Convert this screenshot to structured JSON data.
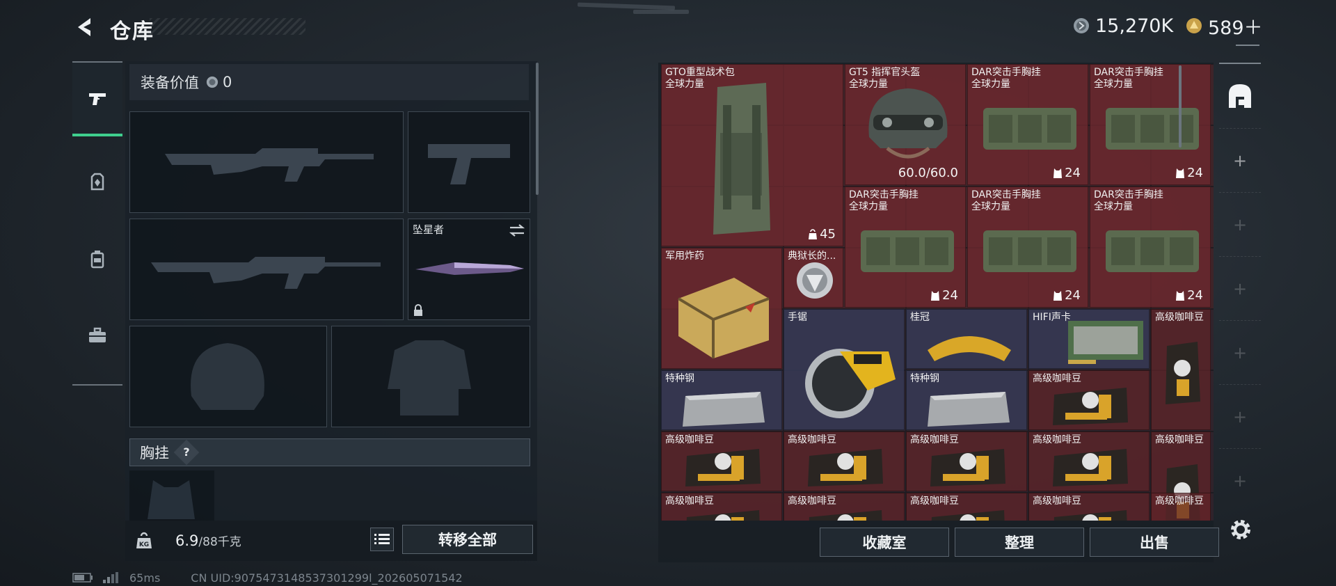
{
  "header": {
    "title": "仓库",
    "currency1": "15,270K",
    "currency2": "589＋"
  },
  "tabs_left": [
    {
      "name": "weapon"
    },
    {
      "name": "armor"
    },
    {
      "name": "backpack"
    },
    {
      "name": "toolbox"
    }
  ],
  "loadout": {
    "value_label": "装备价值",
    "value": "0",
    "melee_name": "坠星者",
    "section_chest": "胸挂",
    "section_help": "?",
    "weight": "6.9",
    "weight_max": "/88千克",
    "transfer_all": "转移全部"
  },
  "inventory": {
    "items": [
      {
        "name": "GTO重型战术包\n全球力量",
        "count": "45",
        "count_icon": "weight"
      },
      {
        "name": "GT5 指挥官头盔\n全球力量",
        "count": "60.0/60.0",
        "count_icon": ""
      },
      {
        "name": "DAR突击手胸挂\n全球力量",
        "count": "24",
        "count_icon": "vest"
      },
      {
        "name": "DAR突击手胸挂\n全球力量",
        "count": "24",
        "count_icon": "vest"
      },
      {
        "name": "DAR突击手胸挂\n全球力量",
        "count": "24",
        "count_icon": "vest"
      },
      {
        "name": "DAR突击手胸挂\n全球力量",
        "count": "24",
        "count_icon": "vest"
      },
      {
        "name": "DAR突击手胸挂\n全球力量",
        "count": "24",
        "count_icon": "vest"
      },
      {
        "name": "军用炸药",
        "count": "",
        "count_icon": ""
      },
      {
        "name": "典狱长的...",
        "count": "",
        "count_icon": ""
      },
      {
        "name": "手锯",
        "count": "",
        "count_icon": ""
      },
      {
        "name": "桂冠",
        "count": "",
        "count_icon": ""
      },
      {
        "name": "HIFI声卡",
        "count": "",
        "count_icon": ""
      },
      {
        "name": "高级咖啡豆",
        "count": "",
        "count_icon": ""
      },
      {
        "name": "特种钢",
        "count": "",
        "count_icon": ""
      },
      {
        "name": "特种钢",
        "count": "",
        "count_icon": ""
      },
      {
        "name": "高级咖啡豆",
        "count": "",
        "count_icon": ""
      },
      {
        "name": "高级咖啡豆",
        "count": "",
        "count_icon": ""
      },
      {
        "name": "高级咖啡豆",
        "count": "",
        "count_icon": ""
      },
      {
        "name": "高级咖啡豆",
        "count": "",
        "count_icon": ""
      },
      {
        "name": "高级咖啡豆",
        "count": "",
        "count_icon": ""
      },
      {
        "name": "高级咖啡豆",
        "count": "",
        "count_icon": ""
      },
      {
        "name": "高级咖啡豆",
        "count": "",
        "count_icon": ""
      },
      {
        "name": "高级咖啡豆",
        "count": "",
        "count_icon": ""
      },
      {
        "name": "高级咖啡豆",
        "count": "",
        "count_icon": ""
      },
      {
        "name": "高级咖啡豆",
        "count": "",
        "count_icon": ""
      },
      {
        "name": "高级咖啡豆",
        "count": "",
        "count_icon": ""
      }
    ],
    "buttons": {
      "collection": "收藏室",
      "sort": "整理",
      "sell": "出售"
    }
  },
  "status": {
    "ping": "65ms",
    "uid": "CN UID:9075473148537301299l_202605071542"
  },
  "colors": {
    "accent_green": "#3fcf8e",
    "item_red": "#6e282e",
    "item_blue": "#363a56",
    "coin_gold": "#c9a24a"
  }
}
